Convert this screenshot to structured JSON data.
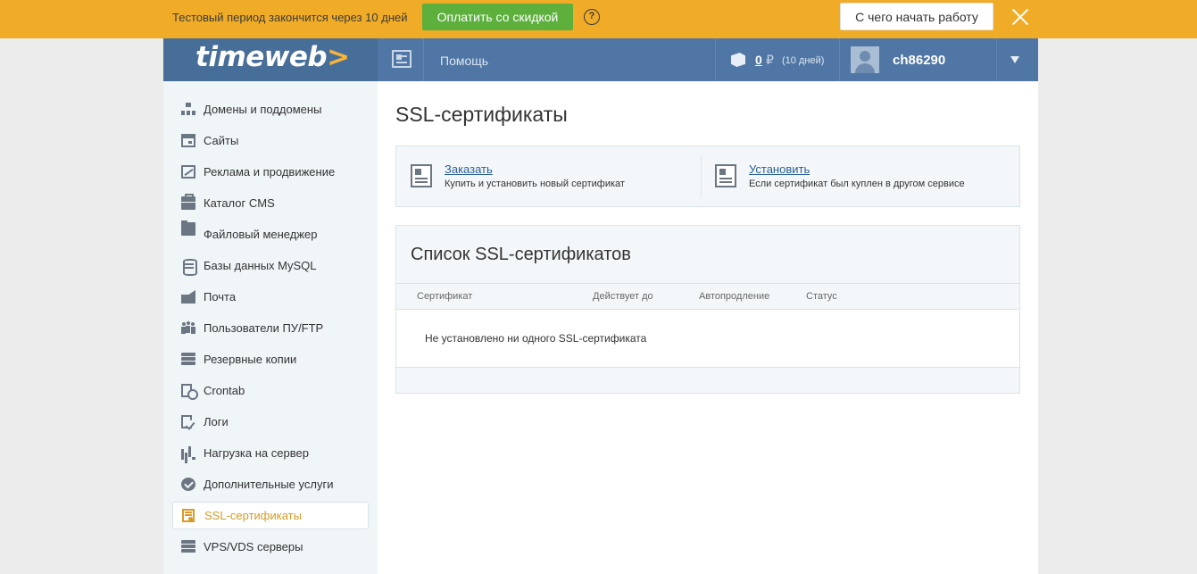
{
  "trial": {
    "text": "Тестовый период закончится через 10 дней",
    "pay_label": "Оплатить со скидкой",
    "help_glyph": "?",
    "start_label": "С чего начать работу"
  },
  "header": {
    "logo_main": "timeweb",
    "logo_arrow": ">",
    "help_label": "Помощь",
    "balance_value": "0",
    "balance_currency": "₽",
    "balance_days": "(10 дней)",
    "username": "ch86290"
  },
  "sidebar": {
    "items": [
      {
        "label": "Домены и поддомены",
        "icon": "sitemap-icon"
      },
      {
        "label": "Сайты",
        "icon": "window-icon"
      },
      {
        "label": "Реклама и продвижение",
        "icon": "chart-icon"
      },
      {
        "label": "Каталог CMS",
        "icon": "box-icon"
      },
      {
        "label": "Файловый менеджер",
        "icon": "folder-icon"
      },
      {
        "label": "Базы данных MySQL",
        "icon": "database-icon"
      },
      {
        "label": "Почта",
        "icon": "mail-icon"
      },
      {
        "label": "Пользователи ПУ/FTP",
        "icon": "users-icon"
      },
      {
        "label": "Резервные копии",
        "icon": "server-icon"
      },
      {
        "label": "Crontab",
        "icon": "clock-icon"
      },
      {
        "label": "Логи",
        "icon": "log-icon"
      },
      {
        "label": "Нагрузка на сервер",
        "icon": "bars-icon"
      },
      {
        "label": "Дополнительные услуги",
        "icon": "gear-icon"
      },
      {
        "label": "SSL-сертификаты",
        "icon": "certificate-icon",
        "active": true
      },
      {
        "label": "VPS/VDS серверы",
        "icon": "server-icon"
      }
    ]
  },
  "main": {
    "title": "SSL-сертификаты",
    "actions": [
      {
        "title": "Заказать",
        "desc": "Купить и установить новый сертификат"
      },
      {
        "title": "Установить",
        "desc": "Если сертификат был куплен в другом сервисе"
      }
    ],
    "list": {
      "title": "Список SSL-сертификатов",
      "columns": [
        "Сертификат",
        "Действует до",
        "Автопродление",
        "Статус"
      ],
      "empty_text": "Не установлено ни одного SSL-сертификата"
    }
  },
  "colors": {
    "banner": "#f0ac27",
    "pay_button": "#5cb03b",
    "header": "#4f76a4",
    "active_item": "#d79b24",
    "link": "#2a5f93"
  }
}
